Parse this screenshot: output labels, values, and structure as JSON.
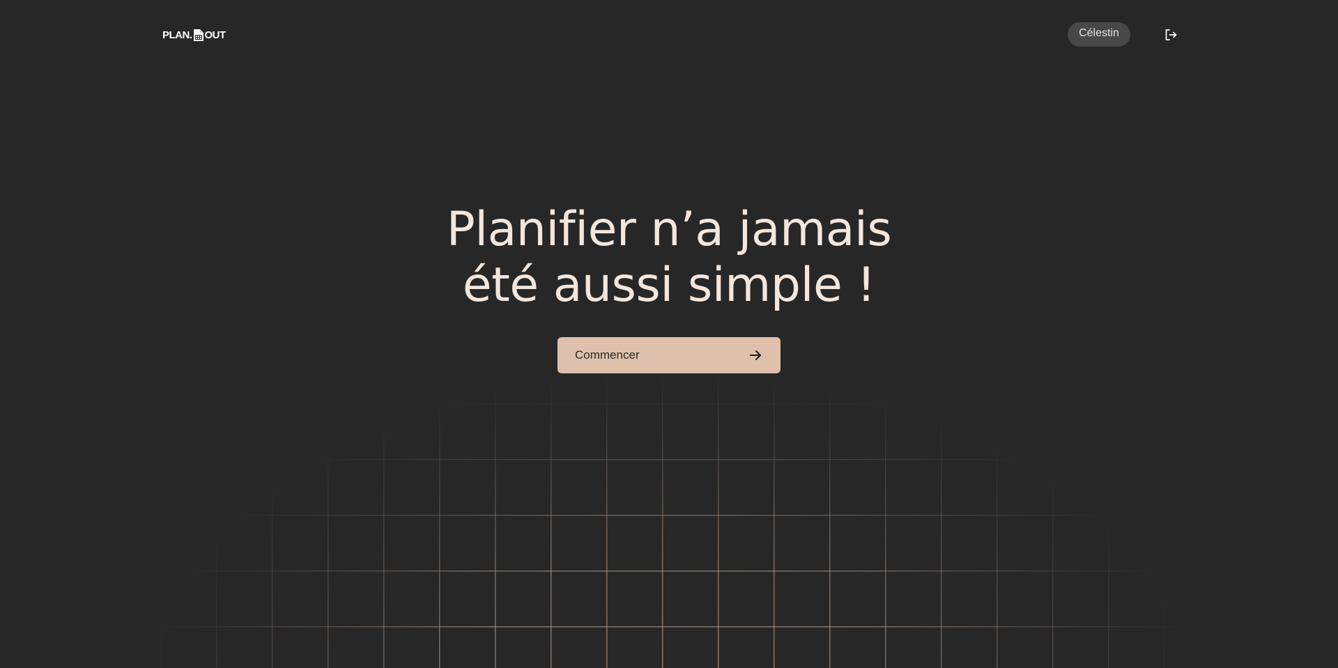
{
  "brand": {
    "logo_left": "PLAN.",
    "logo_right": "OUT"
  },
  "header": {
    "user_name": "Célestin",
    "logout_icon": "logout-icon"
  },
  "hero": {
    "title_line1": "Planifier n’a jamais",
    "title_line2": "été aussi simple !",
    "cta_label": "Commencer",
    "cta_icon": "arrow-right-icon"
  },
  "colors": {
    "background": "#272727",
    "accent": "#dec0ad",
    "title": "#f3e6dd",
    "pill": "#484848"
  }
}
